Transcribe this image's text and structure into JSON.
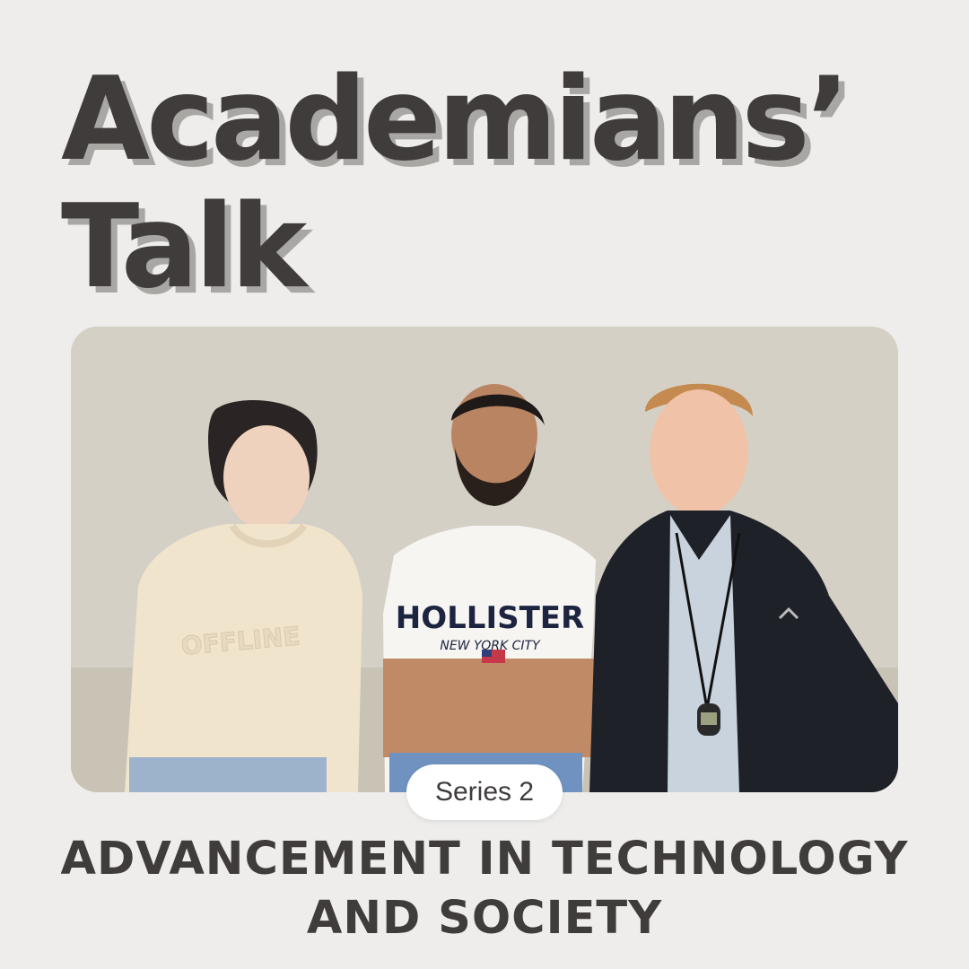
{
  "title": {
    "line1": "Academians’",
    "line2": "Talk"
  },
  "photo": {
    "shirt_text": "HOLLISTER",
    "shirt_subtext": "NEW YORK CITY",
    "sweater_text": "OFFLINE"
  },
  "badge": {
    "label": "Series 2"
  },
  "subtitle": {
    "line1": "ADVANCEMENT IN TECHNOLOGY",
    "line2": "AND SOCIETY"
  },
  "colors": {
    "background": "#eeedeb",
    "title": "#3f3c3b",
    "title_shadow": "#a9a7a4",
    "badge": "#ffffff"
  }
}
